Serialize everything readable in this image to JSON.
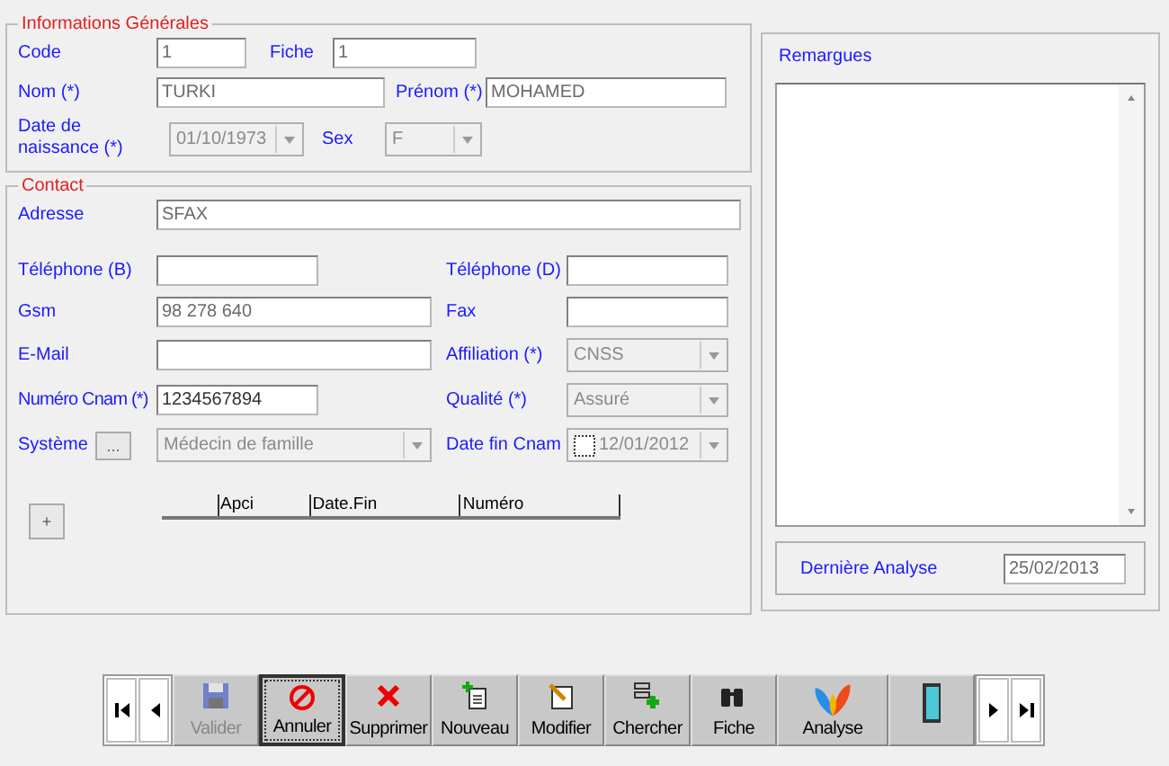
{
  "general": {
    "legend": "Informations Générales",
    "code": {
      "label": "Code",
      "value": "1"
    },
    "fiche": {
      "label": "Fiche",
      "value": "1"
    },
    "nom": {
      "label": "Nom (*)",
      "value": "TURKI"
    },
    "prenom": {
      "label": "Prénom (*)",
      "value": "MOHAMED"
    },
    "naissance": {
      "label": "Date de naissance  (*)",
      "value": "01/10/1973"
    },
    "sex": {
      "label": "Sex",
      "value": "F"
    }
  },
  "contact": {
    "legend": "Contact",
    "adresse": {
      "label": "Adresse",
      "value": "SFAX"
    },
    "tel_b": {
      "label": "Téléphone (B)"
    },
    "tel_d": {
      "label": "Téléphone (D)"
    },
    "gsm": {
      "label": "Gsm",
      "value": "98 278 640"
    },
    "fax": {
      "label": "Fax"
    },
    "email": {
      "label": "E-Mail"
    },
    "affiliation": {
      "label": "Affiliation (*)",
      "value": "CNSS"
    },
    "cnam": {
      "label": "Numéro Cnam (*)",
      "value": "1234567894"
    },
    "qualite": {
      "label": "Qualité (*)",
      "value": "Assuré"
    },
    "systeme": {
      "label": "Système",
      "button": "...",
      "value": "Médecin de famille"
    },
    "date_fin": {
      "label": "Date fin Cnam",
      "checked": false,
      "value": "12/01/2012"
    },
    "table": {
      "columns": [
        "",
        "Apci",
        "Date.Fin",
        "Numéro"
      ]
    },
    "add_button": "+"
  },
  "remarques": {
    "label": "Remargues"
  },
  "derniere_analyse": {
    "label": "Dernière Analyse",
    "value": "25/02/2013"
  },
  "toolbar": [
    {
      "kind": "save",
      "label": "Valider",
      "disabled": true,
      "selected": false
    },
    {
      "kind": "cancel",
      "label": "Annuler",
      "disabled": false,
      "selected": true
    },
    {
      "kind": "delete",
      "label": "Supprimer",
      "disabled": false,
      "selected": false
    },
    {
      "kind": "new",
      "label": "Nouveau",
      "disabled": false,
      "selected": false
    },
    {
      "kind": "edit",
      "label": "Modifier",
      "disabled": false,
      "selected": false
    },
    {
      "kind": "search",
      "label": "Chercher",
      "disabled": false,
      "selected": false
    },
    {
      "kind": "card",
      "label": "Fiche",
      "disabled": false,
      "selected": false
    },
    {
      "kind": "analyse",
      "label": "Analyse",
      "disabled": false,
      "selected": false
    },
    {
      "kind": "exit",
      "disabled": false,
      "selected": false
    }
  ]
}
